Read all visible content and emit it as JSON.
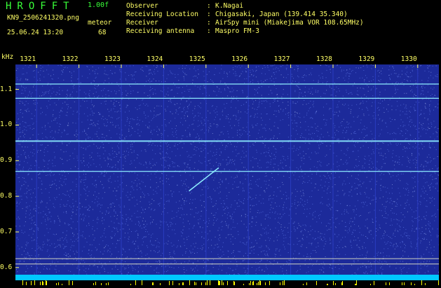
{
  "header": {
    "app_title": "HROFFT",
    "app_version": "1.00f",
    "file_name": "KN9_2506241320.png",
    "datetime": "25.06.24 13:20",
    "meteor_label": "meteor",
    "meteor_count": "68",
    "info": [
      {
        "label": "Observer",
        "value": "K.Nagai"
      },
      {
        "label": "Receiving Location",
        "value": "Chigasaki, Japan (139.414 35.340)"
      },
      {
        "label": "Receiver",
        "value": "AirSpy mini (Miakejima VOR 108.65MHz)"
      },
      {
        "label": "Receiving antenna",
        "value": "Maspro FM-3"
      }
    ],
    "separator": ":"
  },
  "colors": {
    "header_green": "#39ff39",
    "header_yellow": "#ffff66",
    "background": "#1c2a9a",
    "noise": "#6f8cff",
    "carrier": "#8ff0ff",
    "reference_line": "#ffffcc",
    "bottom_strip": "#00c8ff",
    "bottom_bars": "#ffff00"
  },
  "chart_data": {
    "type": "heatmap",
    "ylabel": "kHz",
    "y_ticks": [
      1.1,
      1.0,
      0.9,
      0.8,
      0.7,
      0.6
    ],
    "y_tick_labels": [
      "1.1",
      "1.0",
      "0.9",
      "0.8",
      "0.7",
      "0.6"
    ],
    "y_range": [
      0.58,
      1.17
    ],
    "x_ticks": [
      1321,
      1322,
      1323,
      1324,
      1325,
      1326,
      1327,
      1328,
      1329,
      1330
    ],
    "x_tick_labels": [
      "1321",
      "1322",
      "1323",
      "1324",
      "1325",
      "1326",
      "1327",
      "1328",
      "1329",
      "1330"
    ],
    "x_range": [
      1320.5,
      1330.5
    ],
    "carrier_lines_khz": [
      1.115,
      1.075,
      0.955,
      0.87
    ],
    "reference_lines_khz": [
      0.625,
      0.61
    ],
    "meteor_trace": {
      "x": [
        1324.6,
        1325.3
      ],
      "y_khz": [
        0.815,
        0.88
      ]
    }
  }
}
